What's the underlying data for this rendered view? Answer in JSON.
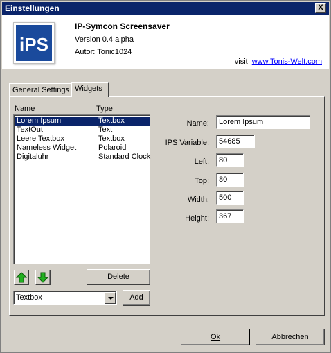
{
  "window": {
    "title": "Einstellungen",
    "close_glyph": "X"
  },
  "header": {
    "logo_text": "iPS",
    "app_name": "IP-Symcon Screensaver",
    "version": "Version 0.4 alpha",
    "author": "Autor: Tonic1024",
    "visit_label": "visit",
    "visit_link": "www.Tonis-Welt.com"
  },
  "tabs": [
    {
      "label": "General Settings",
      "active": false
    },
    {
      "label": "Widgets",
      "active": true
    }
  ],
  "widget_list": {
    "columns": [
      "Name",
      "Type"
    ],
    "rows": [
      {
        "name": "Lorem Ipsum",
        "type": "Textbox",
        "selected": true
      },
      {
        "name": "TextOut",
        "type": "Text",
        "selected": false
      },
      {
        "name": "Leere Textbox",
        "type": "Textbox",
        "selected": false
      },
      {
        "name": "Nameless Widget",
        "type": "Polaroid",
        "selected": false
      },
      {
        "name": "Digitaluhr",
        "type": "Standard Clock",
        "selected": false
      }
    ]
  },
  "buttons": {
    "up_icon": "arrow-up-icon",
    "down_icon": "arrow-down-icon",
    "delete": "Delete",
    "add": "Add",
    "ok": "Ok",
    "cancel": "Abbrechen"
  },
  "type_select": {
    "value": "Textbox"
  },
  "properties": {
    "name_label": "Name:",
    "name_value": "Lorem Ipsum",
    "ips_var_label": "IPS Variable:",
    "ips_var_value": "54685",
    "left_label": "Left:",
    "left_value": "80",
    "top_label": "Top:",
    "top_value": "80",
    "width_label": "Width:",
    "width_value": "500",
    "height_label": "Height:",
    "height_value": "367"
  },
  "colors": {
    "selection": "#0a246a",
    "logo_blue": "#1a4a9c",
    "arrow_green": "#22b020",
    "link": "#0000ff"
  }
}
